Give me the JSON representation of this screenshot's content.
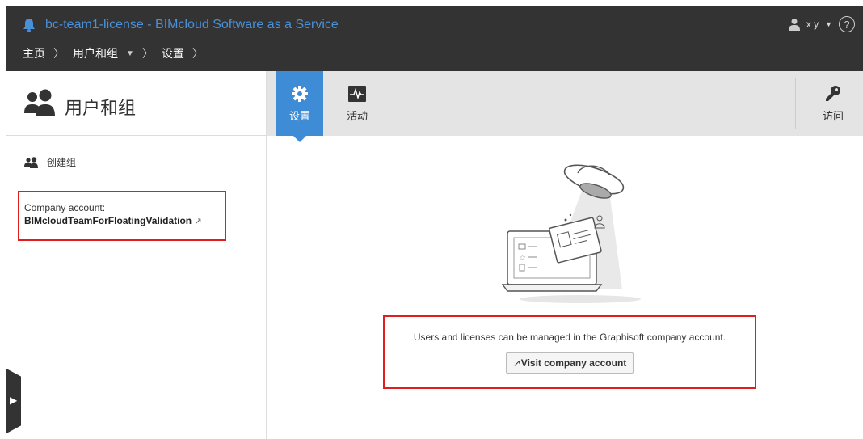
{
  "app": {
    "title": "bc-team1-license - BIMcloud Software as a Service"
  },
  "breadcrumb": {
    "home": "主页",
    "users_groups": "用户和组",
    "settings": "设置"
  },
  "user": {
    "name": "x y",
    "help": "?"
  },
  "sidebar": {
    "title": "用户和组",
    "create_group": "创建组",
    "company_label": "Company account:",
    "company_value": "BIMcloudTeamForFloatingValidation"
  },
  "tabs": [
    {
      "label": "设置",
      "icon": "gear-icon",
      "active": true
    },
    {
      "label": "活动",
      "icon": "activity-icon",
      "active": false
    },
    {
      "label": "访问",
      "icon": "key-icon",
      "active": false
    }
  ],
  "main": {
    "message": "Users and licenses can be managed in the Graphisoft company account.",
    "visit_button": "Visit company account"
  },
  "colors": {
    "topbar_bg": "#333333",
    "accent_blue": "#3e8bd6",
    "title_blue": "#4a90d9",
    "highlight_red": "#e01e1e"
  }
}
